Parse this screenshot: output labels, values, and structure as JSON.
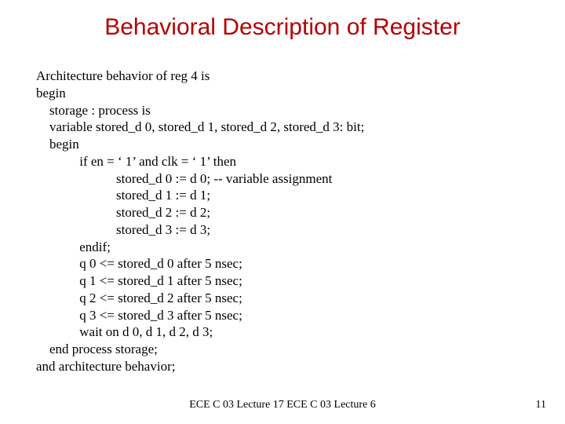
{
  "title": "Behavioral Description of Register",
  "code": "Architecture behavior of reg 4 is\nbegin\n    storage : process is\n    variable stored_d 0, stored_d 1, stored_d 2, stored_d 3: bit;\n    begin\n             if en = ‘ 1’ and clk = ‘ 1’ then\n                        stored_d 0 := d 0; -- variable assignment\n                        stored_d 1 := d 1;\n                        stored_d 2 := d 2;\n                        stored_d 3 := d 3;\n             endif;\n             q 0 <= stored_d 0 after 5 nsec;\n             q 1 <= stored_d 1 after 5 nsec;\n             q 2 <= stored_d 2 after 5 nsec;\n             q 3 <= stored_d 3 after 5 nsec;\n             wait on d 0, d 1, d 2, d 3;\n    end process storage;\nand architecture behavior;",
  "footer_center": "ECE C 03 Lecture 17 ECE C 03 Lecture 6",
  "page_number": "11"
}
